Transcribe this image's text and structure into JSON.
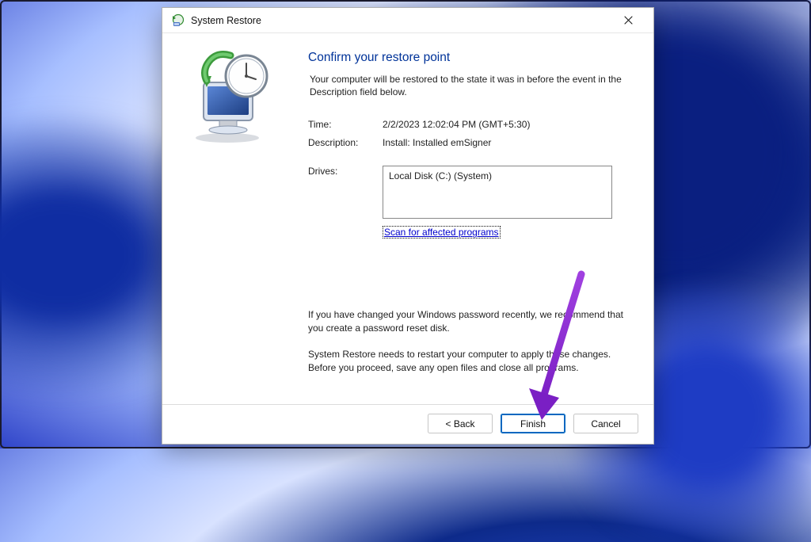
{
  "window": {
    "title": "System Restore"
  },
  "main": {
    "heading": "Confirm your restore point",
    "intro": "Your computer will be restored to the state it was in before the event in the Description field below.",
    "timeLabel": "Time:",
    "timeValue": "2/2/2023 12:02:04 PM (GMT+5:30)",
    "descriptionLabel": "Description:",
    "descriptionValue": "Install: Installed emSigner",
    "drivesLabel": "Drives:",
    "drivesValue": "Local Disk (C:) (System)",
    "scanLink": "Scan for affected programs",
    "note1": "If you have changed your Windows password recently, we recommend that you create a password reset disk.",
    "note2": "System Restore needs to restart your computer to apply these changes. Before you proceed, save any open files and close all programs."
  },
  "footer": {
    "back": "< Back",
    "finish": "Finish",
    "cancel": "Cancel"
  }
}
